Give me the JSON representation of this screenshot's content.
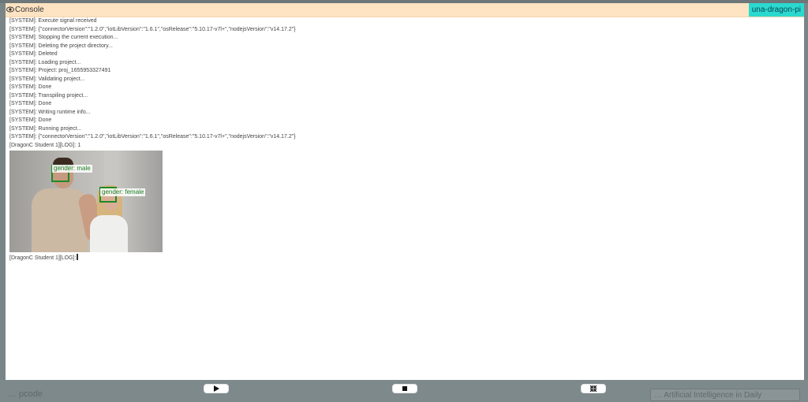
{
  "console": {
    "title": "Console",
    "device": "una-dragon-pi"
  },
  "log_lines": [
    "[SYSTEM]: Execute signal received",
    "[SYSTEM]: {\"connectorVersion\":\"1.2.0\",\"iotLibVersion\":\"1.6.1\",\"osRelease\":\"5.10.17-v7l+\",\"nodejsVersion\":\"v14.17.2\"}",
    "[SYSTEM]: Stopping the current execution...",
    "[SYSTEM]: Deleting the project directory...",
    "[SYSTEM]: Deleted",
    "[SYSTEM]: Loading project...",
    "[SYSTEM]: Project: proj_1655953327491",
    "[SYSTEM]: Validating project...",
    "[SYSTEM]: Done",
    "[SYSTEM]: Transpiling project...",
    "[SYSTEM]: Done",
    "[SYSTEM]: Writing runtime info...",
    "[SYSTEM]: Done",
    "[SYSTEM]: Running project...",
    "[SYSTEM]: {\"connectorVersion\":\"1.2.0\",\"iotLibVersion\":\"1.6.1\",\"osRelease\":\"5.10.17-v7l+\",\"nodejsVersion\":\"v14.17.2\"}",
    "[DragonC Student 1][LOG]: 1"
  ],
  "detections": [
    {
      "label": "gender: male"
    },
    {
      "label": "gender: female"
    }
  ],
  "final_log": "[DragonC Student 1][LOG]:",
  "controls": {
    "play_icon": "play-icon",
    "stop_icon": "stop-icon",
    "collapse_icon": "collapse-icon"
  },
  "background": {
    "bottom_left": "… pcode",
    "bottom_right": "… Artificial Intelligence in Daily"
  }
}
